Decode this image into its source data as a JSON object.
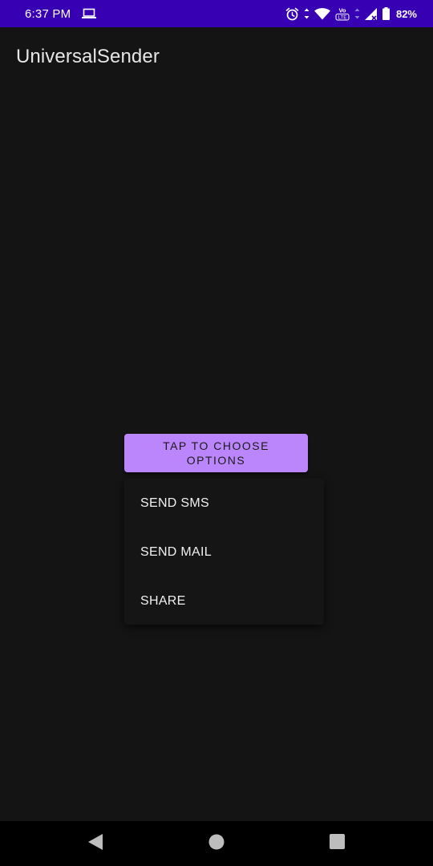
{
  "status_bar": {
    "time": "6:37 PM",
    "battery": "82%",
    "background": "#3700B3",
    "icons": [
      "laptop-icon",
      "alarm-icon",
      "data-arrows-icon",
      "wifi-icon",
      "volte-icon",
      "signal-icon",
      "battery-icon"
    ],
    "volte_label": "LTE"
  },
  "app_bar": {
    "title": "UniversalSender"
  },
  "main": {
    "choose_button_label": "TAP TO CHOOSE OPTIONS",
    "accent_color": "#BB86FC"
  },
  "popup_menu": {
    "items": [
      {
        "label": "SEND SMS"
      },
      {
        "label": "SEND MAIL"
      },
      {
        "label": "SHARE"
      }
    ]
  },
  "nav_bar": {
    "icons": [
      "back-icon",
      "home-icon",
      "recents-icon"
    ]
  }
}
